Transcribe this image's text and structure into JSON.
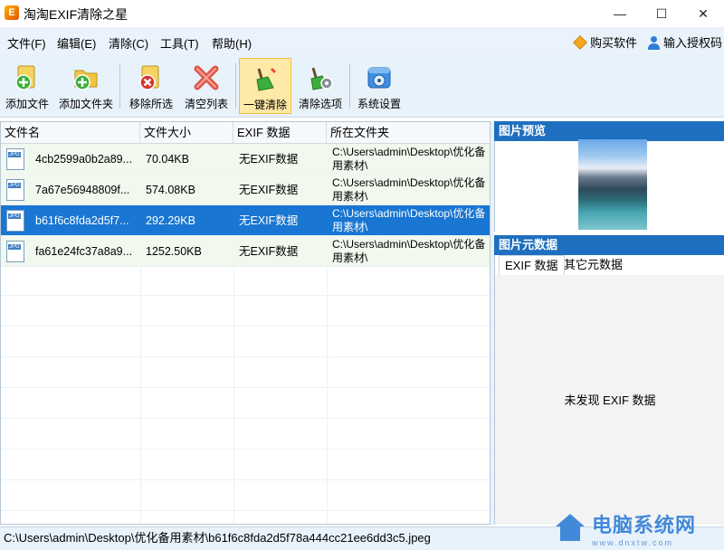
{
  "window": {
    "title": "淘淘EXIF清除之星",
    "minimize": "—",
    "maximize": "☐",
    "close": "✕"
  },
  "menu": {
    "items": [
      "文件(F)",
      "编辑(E)",
      "清除(C)",
      "工具(T)",
      "帮助(H)"
    ],
    "buy": "购买软件",
    "license": "输入授权码"
  },
  "toolbar": {
    "add_file": "添加文件",
    "add_folder": "添加文件夹",
    "remove_selected": "移除所选",
    "clear_list": "清空列表",
    "one_click_clean": "一键清除",
    "clean_options": "清除选项",
    "settings": "系统设置"
  },
  "filelist": {
    "columns": [
      "文件名",
      "文件大小",
      "EXIF 数据",
      "所在文件夹"
    ],
    "rows": [
      {
        "name": "4cb2599a0b2a89...",
        "size": "70.04KB",
        "exif": "无EXIF数据",
        "folder": "C:\\Users\\admin\\Desktop\\优化备用素材\\"
      },
      {
        "name": "7a67e56948809f...",
        "size": "574.08KB",
        "exif": "无EXIF数据",
        "folder": "C:\\Users\\admin\\Desktop\\优化备用素材\\"
      },
      {
        "name": "b61f6c8fda2d5f7...",
        "size": "292.29KB",
        "exif": "无EXIF数据",
        "folder": "C:\\Users\\admin\\Desktop\\优化备用素材\\"
      },
      {
        "name": "fa61e24fc37a8a9...",
        "size": "1252.50KB",
        "exif": "无EXIF数据",
        "folder": "C:\\Users\\admin\\Desktop\\优化备用素材\\"
      }
    ],
    "selected_index": 2
  },
  "preview": {
    "title": "图片预览"
  },
  "metadata": {
    "title": "图片元数据",
    "tabs": [
      "EXIF 数据",
      "其它元数据"
    ],
    "empty_message": "未发现 EXIF 数据"
  },
  "status": {
    "path": "C:\\Users\\admin\\Desktop\\优化备用素材\\b61f6c8fda2d5f78a444cc21ee6dd3c5.jpeg"
  },
  "watermark": {
    "text": "电脑系统网",
    "url": "www.dnxtw.com"
  },
  "colors": {
    "accent": "#1e6fbf",
    "selected_row": "#1976d2",
    "toolbar_bg": "#e8f2fb",
    "active_button": "#ffe9a6"
  }
}
